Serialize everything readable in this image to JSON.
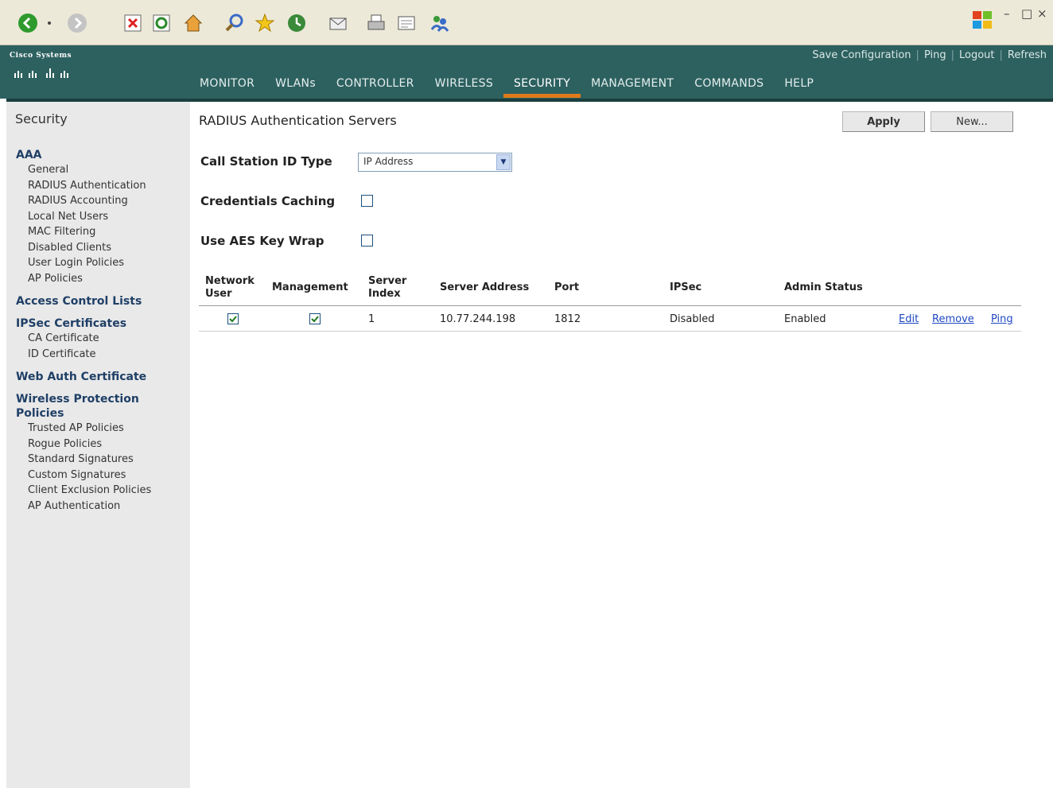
{
  "header": {
    "brand": "Cisco Systems",
    "util_links": [
      "Save Configuration",
      "Ping",
      "Logout",
      "Refresh"
    ],
    "nav": [
      "MONITOR",
      "WLANs",
      "CONTROLLER",
      "WIRELESS",
      "SECURITY",
      "MANAGEMENT",
      "COMMANDS",
      "HELP"
    ],
    "active_nav": "SECURITY",
    "colors": {
      "header_bg": "#2d6160",
      "active_underline": "#e07a1a"
    }
  },
  "sidebar": {
    "title": "Security",
    "groups": [
      {
        "label": "AAA",
        "items": [
          "General",
          "RADIUS Authentication",
          "RADIUS Accounting",
          "Local Net Users",
          "MAC Filtering",
          "Disabled Clients",
          "User Login Policies",
          "AP Policies"
        ]
      },
      {
        "label": "Access Control Lists",
        "items": []
      },
      {
        "label": "IPSec Certificates",
        "items": [
          "CA Certificate",
          "ID Certificate"
        ]
      },
      {
        "label": "Web Auth Certificate",
        "items": []
      },
      {
        "label": "Wireless Protection Policies",
        "items": [
          "Trusted AP Policies",
          "Rogue Policies",
          "Standard Signatures",
          "Custom Signatures",
          "Client Exclusion Policies",
          "AP Authentication"
        ]
      }
    ]
  },
  "main": {
    "title": "RADIUS Authentication Servers",
    "apply_label": "Apply",
    "new_label": "New...",
    "call_station_label": "Call Station ID Type",
    "call_station_value": "IP Address",
    "credentials_caching_label": "Credentials Caching",
    "credentials_caching_checked": false,
    "aes_key_wrap_label": "Use AES Key Wrap",
    "aes_key_wrap_checked": false,
    "table": {
      "headers": {
        "network_user": "Network User",
        "management": "Management",
        "server_index": "Server Index",
        "server_address": "Server Address",
        "port": "Port",
        "ipsec": "IPSec",
        "admin_status": "Admin Status"
      },
      "rows": [
        {
          "network_user": true,
          "management": true,
          "server_index": "1",
          "server_address": "10.77.244.198",
          "port": "1812",
          "ipsec": "Disabled",
          "admin_status": "Enabled",
          "actions": [
            "Edit",
            "Remove",
            "Ping"
          ]
        }
      ]
    }
  }
}
